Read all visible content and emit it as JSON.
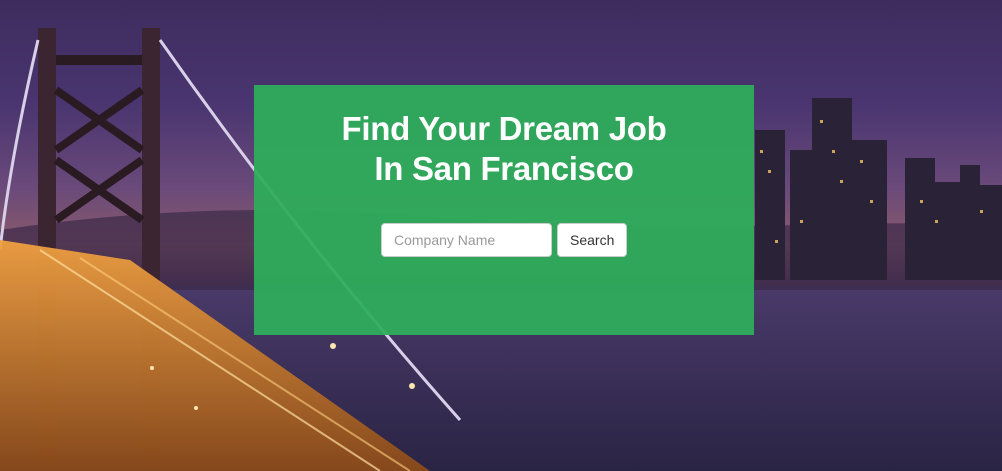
{
  "hero": {
    "title_line1": "Find Your Dream Job",
    "title_line2": "In San Francisco"
  },
  "search": {
    "placeholder": "Company Name",
    "button_label": "Search"
  },
  "colors": {
    "card": "#2ead5a",
    "button_bg": "#ffffff"
  }
}
